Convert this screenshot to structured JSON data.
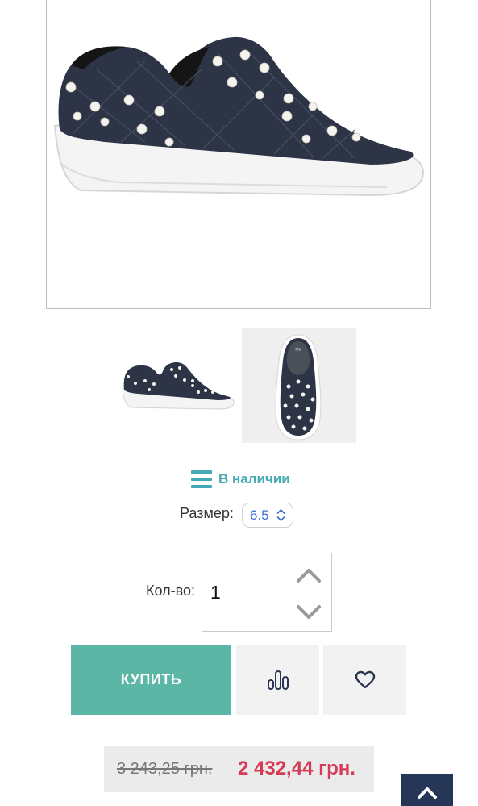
{
  "product": {
    "stock_status": "В наличии",
    "size_label": "Размер:",
    "size_value": "6.5",
    "quantity_label": "Кол-во:",
    "quantity_value": "1",
    "buy_label": "КУПИТЬ",
    "price_old": "3 243,25 грн.",
    "price_new": "2 432,44 грн."
  },
  "icons": {
    "stock": "list-icon",
    "size": "chevron-updown-icon",
    "qty_up": "chevron-up-icon",
    "qty_down": "chevron-down-icon",
    "compare": "bar-chart-icon",
    "wishlist": "heart-icon",
    "scroll_top": "chevron-up-icon"
  },
  "colors": {
    "accent_teal": "#45a9b6",
    "buy_button": "#5bb6a6",
    "price_new": "#d63a55",
    "scroll_top": "#253656",
    "size_value": "#3b6fd1"
  }
}
